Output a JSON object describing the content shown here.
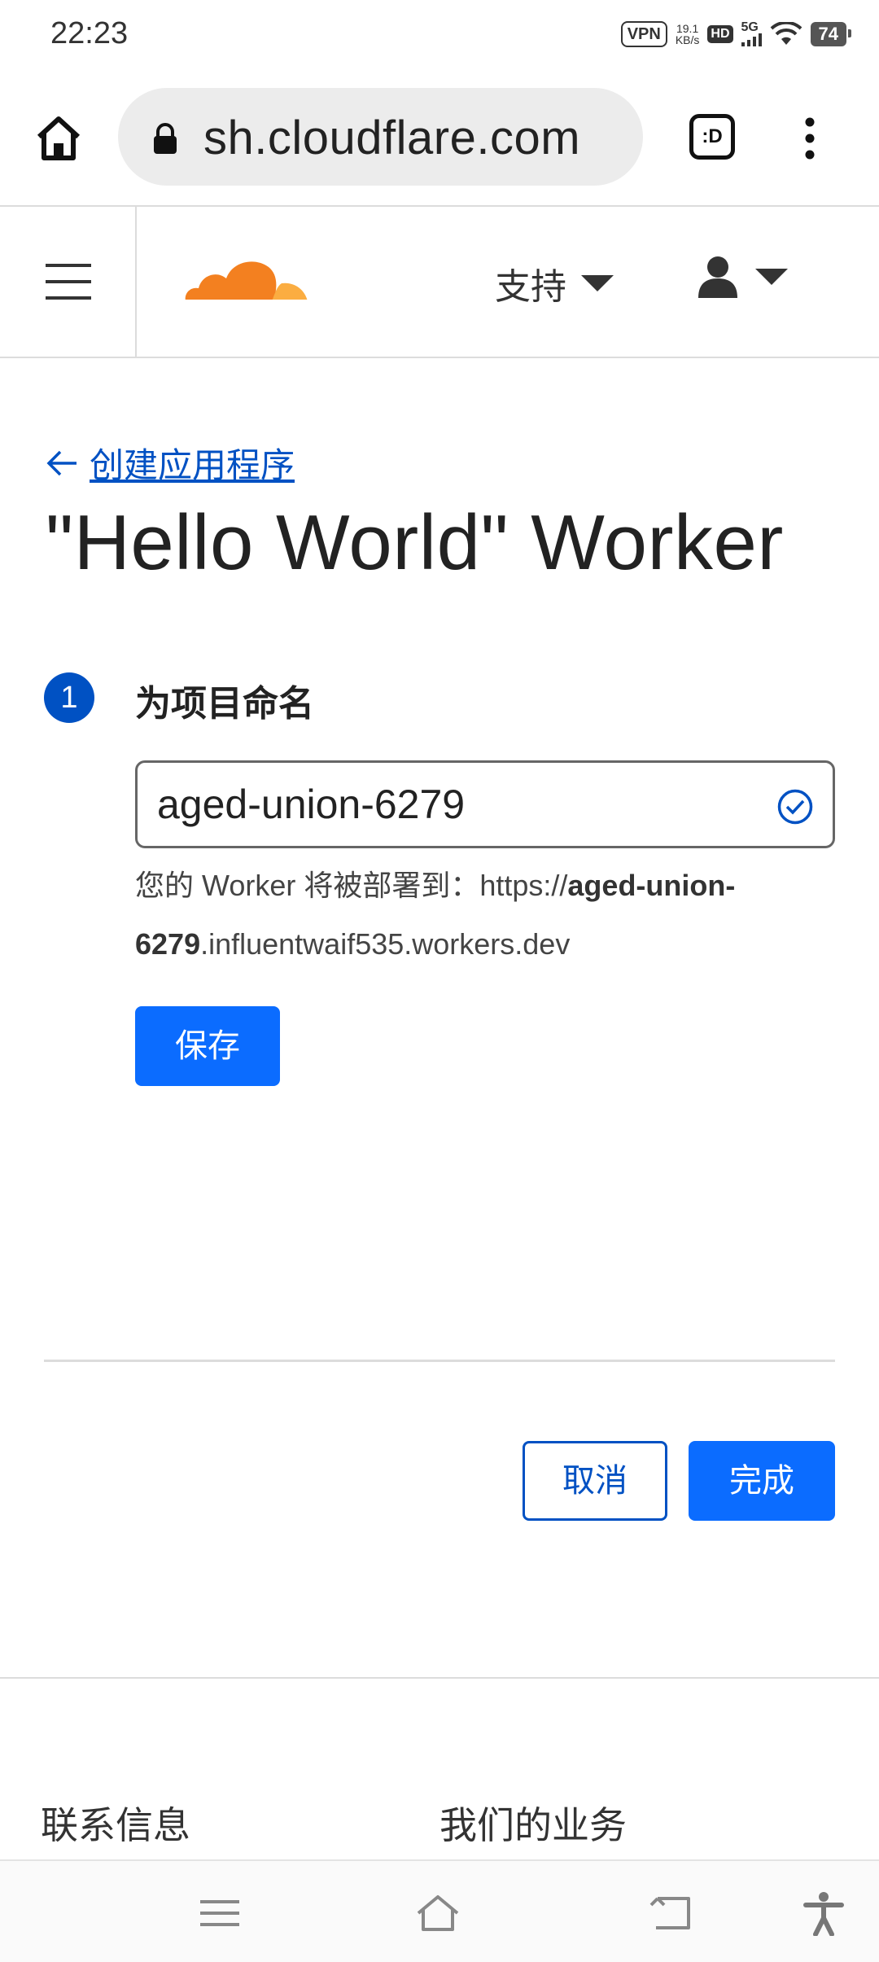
{
  "status_bar": {
    "time": "22:23",
    "vpn": "VPN",
    "speed_value": "19.1",
    "speed_unit": "KB/s",
    "hd": "HD",
    "network": "5G",
    "battery": "74"
  },
  "browser": {
    "url": "sh.cloudflare.com",
    "tab_switcher": ":D"
  },
  "header": {
    "support_label": "支持"
  },
  "main": {
    "back_link": "创建应用程序",
    "title": "\"Hello World\" Worker",
    "step_number": "1",
    "step_title": "为项目命名",
    "project_name": "aged-union-6279",
    "deploy_prefix": "您的 Worker 将被部署到：https://",
    "deploy_name_part1": "aged-union-",
    "deploy_name_part2": "6279",
    "deploy_suffix": ".influentwaif535.workers.dev",
    "save_label": "保存",
    "cancel_label": "取消",
    "done_label": "完成"
  },
  "footer": {
    "contact": "联系信息",
    "business": "我们的业务"
  },
  "colors": {
    "primary": "#0b6cff",
    "link": "#0051c3",
    "cloudflare_orange": "#f38020",
    "cloudflare_light_orange": "#fbad41"
  }
}
